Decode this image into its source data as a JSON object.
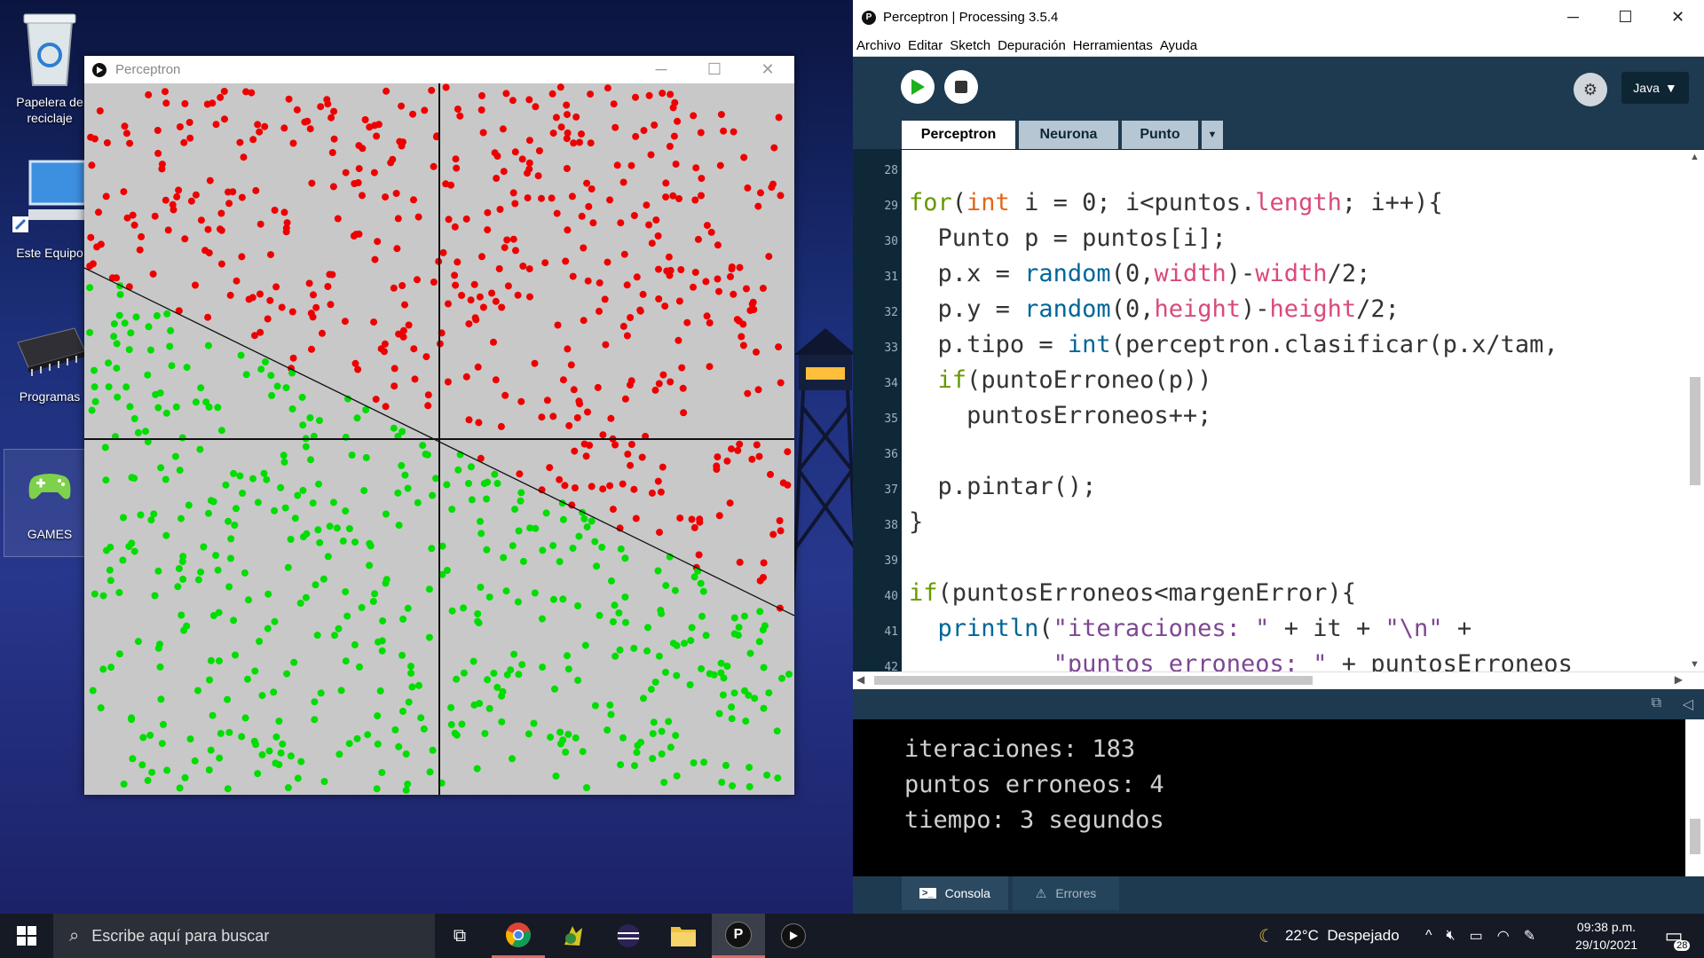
{
  "desktop": {
    "icons": [
      {
        "label": "Papelera de reciclaje"
      },
      {
        "label": "Este Equipo"
      },
      {
        "label": "Programas"
      },
      {
        "label": "GAMES"
      }
    ]
  },
  "sketch": {
    "title": "Perceptron",
    "controls": [
      "─",
      "☐",
      "✕"
    ]
  },
  "ide": {
    "title": "Perceptron | Processing 3.5.4",
    "menu": [
      "Archivo",
      "Editar",
      "Sketch",
      "Depuración",
      "Herramientas",
      "Ayuda"
    ],
    "mode": "Java",
    "tabs": [
      "Perceptron",
      "Neurona",
      "Punto"
    ],
    "active_tab": "Perceptron",
    "line_numbers": [
      "28",
      "29",
      "30",
      "31",
      "32",
      "33",
      "34",
      "35",
      "36",
      "37",
      "38",
      "39",
      "40",
      "41",
      "42"
    ],
    "code_lines": [
      "",
      "for(int i = 0; i<puntos.length; i++){",
      "  Punto p = puntos[i];",
      "  p.x = random(0,width)-width/2;",
      "  p.y = random(0,height)-height/2;",
      "  p.tipo = int(perceptron.clasificar(p.x/tam,",
      "  if(puntoErroneo(p))",
      "    puntosErroneos++;",
      "",
      "  p.pintar();",
      "}",
      "",
      "if(puntosErroneos<margenError){",
      "  println(\"iteraciones: \" + it + \"\\n\" +",
      "          \"puntos erroneos: \" + puntosErroneos"
    ],
    "console_lines": [
      "iteraciones: 183",
      "puntos erroneos: 4",
      "tiempo: 3 segundos"
    ],
    "console_tabs": [
      "Consola",
      "Errores"
    ]
  },
  "taskbar": {
    "search_placeholder": "Escribe aquí para buscar",
    "weather": "22°C  Despejado",
    "time": "09:38 p.m.",
    "date": "29/10/2021",
    "notifications": "28"
  },
  "colors": {
    "red_point": "#ee0000",
    "green_point": "#00dd00",
    "canvas_bg": "#c8c8c8"
  }
}
